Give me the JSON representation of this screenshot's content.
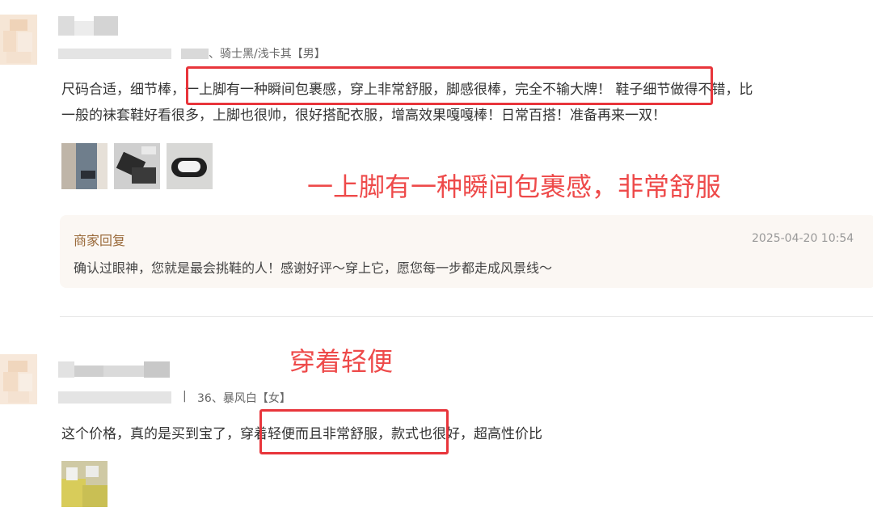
{
  "reviews": [
    {
      "variant_text": "、骑士黑/浅卡其【男】",
      "content_line1": "尺码合适，细节棒，一上脚有一种瞬间包裹感，穿上非常舒服，脚感很棒，完全不输大牌！ 鞋子细节做得不错，比",
      "content_line2": "一般的袜套鞋好看很多，上脚也很帅，很好搭配衣服，增高效果嘎嘎棒！日常百搭！准备再来一双！",
      "annotation": "一上脚有一种瞬间包裹感，非常舒服",
      "reply": {
        "title": "商家回复",
        "time": "2025-04-20 10:54",
        "text": "确认过眼神，您就是最会挑鞋的人！感谢好评～穿上它，愿您每一步都走成风景线～"
      }
    },
    {
      "annotation": "穿着轻便",
      "meta_sep": "|",
      "variant_text": "36、暴风白【女】",
      "content_line1": "这个价格，真的是买到宝了，穿着轻便而且非常舒服，款式也很好，超高性价比"
    }
  ],
  "colors": {
    "annotation": "#ee4a4a",
    "highlight_box": "#e8353b",
    "reply_bg": "#fbf7f3",
    "reply_title": "#9a6a3a"
  }
}
